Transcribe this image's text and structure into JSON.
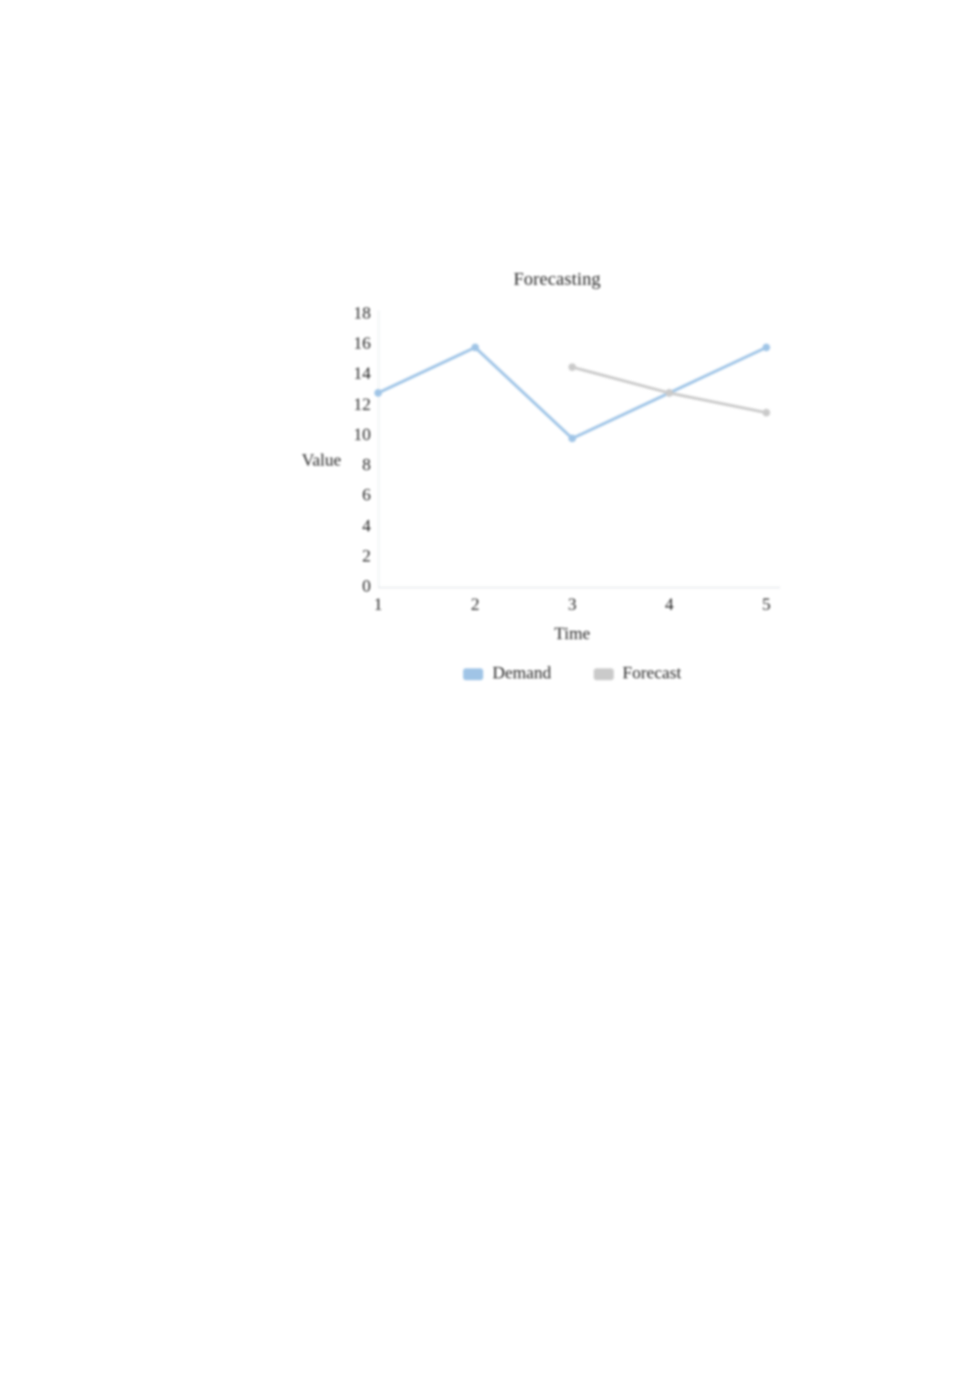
{
  "chart": {
    "title": "Forecasting",
    "x_axis_title": "Time",
    "y_axis_title": "Value",
    "legend": [
      {
        "label": "Demand",
        "color": "#9DC3E6"
      },
      {
        "label": "Forecast",
        "color": "#C9C9C9"
      }
    ]
  },
  "chart_data": {
    "type": "line",
    "title": "Forecasting",
    "xlabel": "Time",
    "ylabel": "Value",
    "categories": [
      "1",
      "2",
      "3",
      "4",
      "5"
    ],
    "x": [
      1,
      2,
      3,
      4,
      5
    ],
    "xlim": [
      1,
      5
    ],
    "ylim": [
      0,
      18
    ],
    "y_ticks": [
      0,
      2,
      4,
      6,
      8,
      10,
      12,
      14,
      16,
      18
    ],
    "x_ticks": [
      "1",
      "2",
      "3",
      "4",
      "5"
    ],
    "grid": false,
    "legend_position": "bottom",
    "markers": true,
    "series": [
      {
        "name": "Demand",
        "color": "#9DC3E6",
        "values": [
          12.8,
          15.8,
          9.8,
          12.8,
          15.8
        ]
      },
      {
        "name": "Forecast",
        "color": "#C9C9C9",
        "values": [
          null,
          null,
          14.5,
          12.8,
          11.5
        ]
      }
    ]
  }
}
